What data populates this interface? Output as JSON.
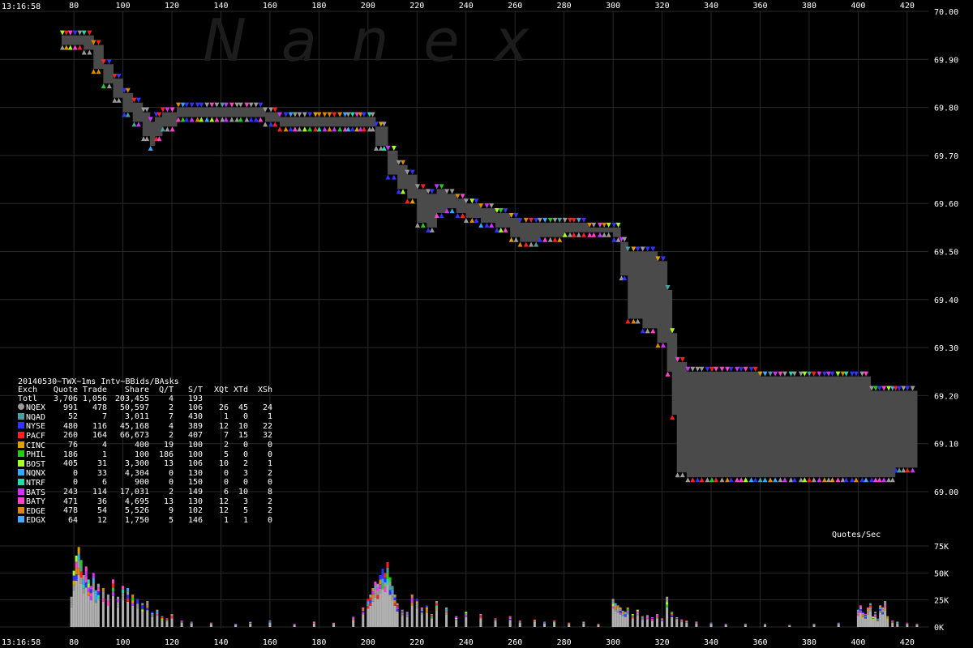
{
  "header": {
    "time_top": "13:16:58",
    "time_bottom": "13:16:58",
    "watermark": "N  a  n  e  x"
  },
  "chart_data": [
    {
      "type": "line",
      "title": "20140530~TWX~1ms Intv~BBids/BAsks",
      "x_ticks": [
        80,
        100,
        120,
        140,
        160,
        180,
        200,
        220,
        240,
        260,
        280,
        300,
        320,
        340,
        360,
        380,
        400,
        420
      ],
      "xlim": [
        75,
        427
      ],
      "y_ticks": [
        "70.00",
        "69.90",
        "69.80",
        "69.70",
        "69.60",
        "69.50",
        "69.40",
        "69.30",
        "69.20",
        "69.10",
        "69.00"
      ],
      "ylim": [
        68.985,
        70.0
      ],
      "grid": true,
      "series": [
        {
          "name": "",
          "x": [
            75,
            82,
            84,
            88,
            92,
            96,
            100,
            104,
            108,
            111,
            113,
            116,
            122,
            130,
            140,
            150,
            158,
            164,
            170,
            180,
            190,
            195,
            200,
            203,
            208,
            212,
            216,
            220,
            224,
            228,
            232,
            236,
            240,
            246,
            252,
            258,
            262,
            270,
            280,
            290,
            298,
            300,
            303,
            306,
            312,
            318,
            322,
            324,
            326,
            330,
            340,
            350,
            360,
            380,
            395,
            405,
            410,
            412,
            415,
            420,
            424
          ],
          "bid": [
            69.93,
            69.93,
            69.92,
            69.88,
            69.85,
            69.82,
            69.79,
            69.77,
            69.74,
            69.72,
            69.74,
            69.76,
            69.78,
            69.78,
            69.78,
            69.78,
            69.77,
            69.76,
            69.76,
            69.76,
            69.76,
            69.76,
            69.76,
            69.72,
            69.66,
            69.63,
            69.61,
            69.56,
            69.55,
            69.58,
            69.59,
            69.58,
            69.57,
            69.56,
            69.55,
            69.53,
            69.52,
            69.53,
            69.54,
            69.54,
            69.54,
            69.53,
            69.45,
            69.36,
            69.34,
            69.31,
            69.25,
            69.16,
            69.04,
            69.03,
            69.03,
            69.03,
            69.03,
            69.03,
            69.03,
            69.03,
            69.03,
            69.03,
            69.05,
            69.05,
            69.05
          ],
          "ask": [
            69.95,
            69.95,
            69.95,
            69.93,
            69.89,
            69.86,
            69.83,
            69.81,
            69.79,
            69.77,
            69.78,
            69.79,
            69.8,
            69.8,
            69.8,
            69.8,
            69.79,
            69.78,
            69.78,
            69.78,
            69.78,
            69.78,
            69.78,
            69.76,
            69.71,
            69.68,
            69.66,
            69.63,
            69.62,
            69.63,
            69.62,
            69.61,
            69.6,
            69.59,
            69.58,
            69.57,
            69.56,
            69.56,
            69.56,
            69.55,
            69.55,
            69.55,
            69.52,
            69.5,
            69.5,
            69.48,
            69.42,
            69.33,
            69.27,
            69.25,
            69.25,
            69.25,
            69.24,
            69.24,
            69.24,
            69.21,
            69.21,
            69.21,
            69.21,
            69.21,
            69.1
          ]
        }
      ]
    },
    {
      "type": "bar",
      "title": "Quotes/Sec",
      "x_ticks": [
        80,
        100,
        120,
        140,
        160,
        180,
        200,
        220,
        240,
        260,
        280,
        300,
        320,
        340,
        360,
        380,
        400,
        420
      ],
      "y_ticks": [
        "75K",
        "50K",
        "25K",
        "0K"
      ],
      "ylim": [
        0,
        78000
      ],
      "x": [
        79,
        80,
        81,
        82,
        83,
        84,
        85,
        86,
        87,
        88,
        89,
        90,
        92,
        94,
        96,
        98,
        100,
        102,
        104,
        106,
        108,
        110,
        112,
        114,
        116,
        118,
        120,
        124,
        128,
        136,
        146,
        152,
        160,
        170,
        178,
        186,
        194,
        198,
        200,
        201,
        202,
        203,
        204,
        205,
        206,
        207,
        208,
        209,
        210,
        211,
        212,
        214,
        216,
        218,
        220,
        222,
        224,
        226,
        228,
        232,
        236,
        240,
        246,
        252,
        258,
        262,
        268,
        272,
        276,
        282,
        288,
        294,
        300,
        301,
        302,
        303,
        304,
        305,
        306,
        308,
        310,
        312,
        314,
        316,
        318,
        320,
        322,
        324,
        326,
        328,
        330,
        334,
        340,
        346,
        354,
        362,
        372,
        382,
        392,
        400,
        401,
        402,
        403,
        404,
        405,
        406,
        407,
        408,
        409,
        410,
        411,
        412,
        414,
        416,
        420,
        424
      ],
      "values": [
        28000,
        52000,
        66000,
        74000,
        62000,
        48000,
        56000,
        44000,
        38000,
        50000,
        34000,
        40000,
        36000,
        30000,
        44000,
        28000,
        38000,
        36000,
        30000,
        26000,
        22000,
        24000,
        14000,
        16000,
        10000,
        8000,
        12000,
        6000,
        5000,
        4000,
        3000,
        5000,
        6000,
        3000,
        5000,
        4000,
        10000,
        18000,
        26000,
        30000,
        36000,
        42000,
        40000,
        48000,
        54000,
        50000,
        60000,
        46000,
        38000,
        30000,
        22000,
        16000,
        14000,
        30000,
        26000,
        18000,
        20000,
        12000,
        24000,
        18000,
        10000,
        14000,
        12000,
        8000,
        10000,
        6000,
        7000,
        5000,
        6000,
        4000,
        5000,
        3000,
        26000,
        22000,
        20000,
        18000,
        15000,
        14000,
        18000,
        12000,
        16000,
        10000,
        11000,
        9000,
        12000,
        8000,
        28000,
        14000,
        9000,
        7000,
        6000,
        5000,
        4000,
        3000,
        3000,
        3000,
        2000,
        3000,
        4000,
        16000,
        20000,
        14000,
        12000,
        18000,
        22000,
        10000,
        14000,
        8000,
        20000,
        18000,
        24000,
        10000,
        6000,
        5000,
        4000,
        3000
      ]
    }
  ],
  "stats": {
    "title": "20140530~TWX~1ms Intv~BBids/BAsks",
    "columns": [
      "Exch",
      "Quote",
      "Trade",
      "Share",
      "Q/T",
      "S/T",
      "XQt",
      "XTd",
      "XSh"
    ],
    "rows": [
      {
        "exch": "Totl",
        "quote": "3,706",
        "trade": "1,056",
        "share": "203,455",
        "qt": "4",
        "st": "193",
        "xqt": "",
        "xtd": "",
        "xsh": "",
        "color": ""
      },
      {
        "exch": "NQEX",
        "quote": "991",
        "trade": "478",
        "share": "50,597",
        "qt": "2",
        "st": "106",
        "xqt": "26",
        "xtd": "45",
        "xsh": "24",
        "color": "#9a9a9a"
      },
      {
        "exch": "NQAD",
        "quote": "52",
        "trade": "7",
        "share": "3,011",
        "qt": "7",
        "st": "430",
        "xqt": "1",
        "xtd": "0",
        "xsh": "1",
        "color": "#4aa0a0"
      },
      {
        "exch": "NYSE",
        "quote": "480",
        "trade": "116",
        "share": "45,168",
        "qt": "4",
        "st": "389",
        "xqt": "12",
        "xtd": "10",
        "xsh": "22",
        "color": "#3333ff"
      },
      {
        "exch": "PACF",
        "quote": "260",
        "trade": "164",
        "share": "66,673",
        "qt": "2",
        "st": "407",
        "xqt": "7",
        "xtd": "15",
        "xsh": "32",
        "color": "#ff2020"
      },
      {
        "exch": "CINC",
        "quote": "76",
        "trade": "4",
        "share": "400",
        "qt": "19",
        "st": "100",
        "xqt": "2",
        "xtd": "0",
        "xsh": "0",
        "color": "#e0a000"
      },
      {
        "exch": "PHIL",
        "quote": "186",
        "trade": "1",
        "share": "100",
        "qt": "186",
        "st": "100",
        "xqt": "5",
        "xtd": "0",
        "xsh": "0",
        "color": "#22cc22"
      },
      {
        "exch": "BOST",
        "quote": "405",
        "trade": "31",
        "share": "3,300",
        "qt": "13",
        "st": "106",
        "xqt": "10",
        "xtd": "2",
        "xsh": "1",
        "color": "#aaff22"
      },
      {
        "exch": "NQNX",
        "quote": "0",
        "trade": "33",
        "share": "4,304",
        "qt": "0",
        "st": "130",
        "xqt": "0",
        "xtd": "3",
        "xsh": "2",
        "color": "#33aaff"
      },
      {
        "exch": "NTRF",
        "quote": "0",
        "trade": "6",
        "share": "900",
        "qt": "0",
        "st": "150",
        "xqt": "0",
        "xtd": "0",
        "xsh": "0",
        "color": "#22ddaa"
      },
      {
        "exch": "BATS",
        "quote": "243",
        "trade": "114",
        "share": "17,031",
        "qt": "2",
        "st": "149",
        "xqt": "6",
        "xtd": "10",
        "xsh": "8",
        "color": "#cc33ff"
      },
      {
        "exch": "BATY",
        "quote": "471",
        "trade": "36",
        "share": "4,695",
        "qt": "13",
        "st": "130",
        "xqt": "12",
        "xtd": "3",
        "xsh": "2",
        "color": "#ff44cc"
      },
      {
        "exch": "EDGE",
        "quote": "478",
        "trade": "54",
        "share": "5,526",
        "qt": "9",
        "st": "102",
        "xqt": "12",
        "xtd": "5",
        "xsh": "2",
        "color": "#dd8800"
      },
      {
        "exch": "EDGX",
        "quote": "64",
        "trade": "12",
        "share": "1,750",
        "qt": "5",
        "st": "146",
        "xqt": "1",
        "xtd": "1",
        "xsh": "0",
        "color": "#44aaff"
      }
    ]
  },
  "colors": {
    "background": "#000000",
    "grid": "#2a2a2a",
    "band": "#4a4a4a",
    "axis_text": "#ffffff",
    "bid_marker": "#9a9a9a",
    "ask_marker": "#a0a0a0"
  }
}
